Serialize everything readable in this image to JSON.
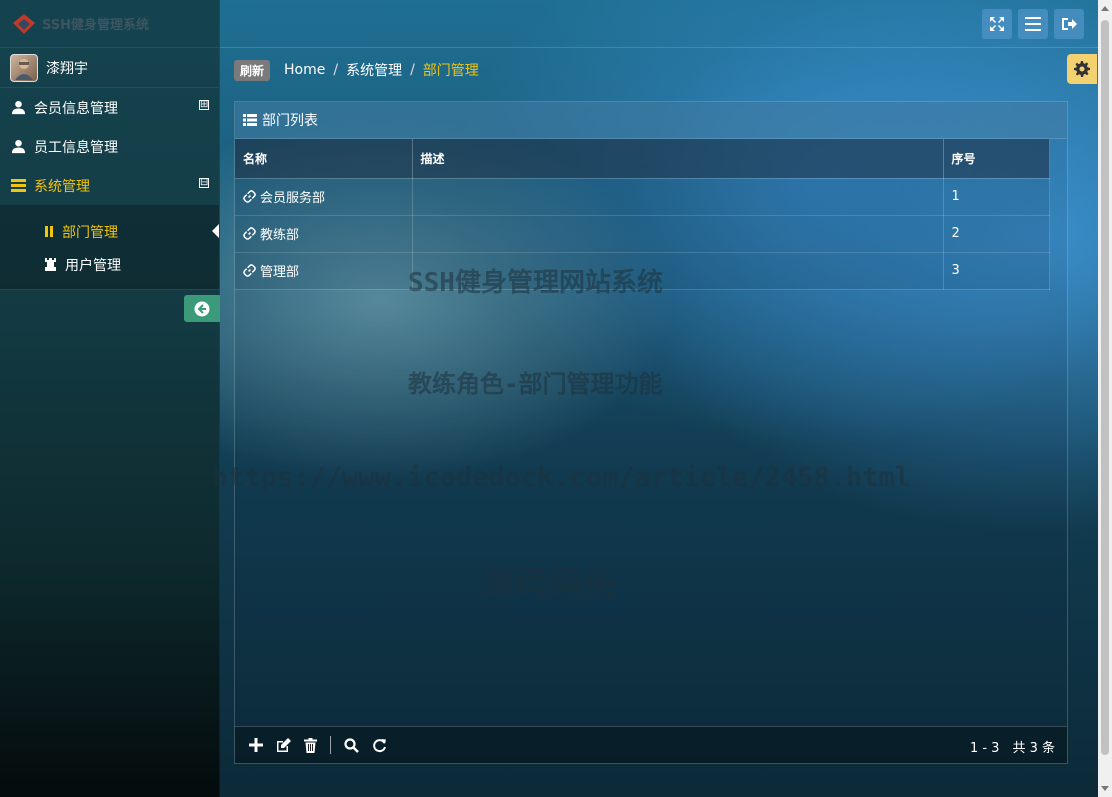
{
  "app": {
    "logo_text": "SSH健身管理系统"
  },
  "user": {
    "name": "漆翔宇"
  },
  "sidebar": {
    "items": [
      {
        "label": "会员信息管理",
        "icon": "user-icon",
        "expand": "⊞"
      },
      {
        "label": "员工信息管理",
        "icon": "user-icon"
      },
      {
        "label": "系统管理",
        "icon": "list-icon",
        "expand": "⊟"
      }
    ],
    "sub_items": [
      {
        "label": "部门管理",
        "icon": "pause-icon"
      },
      {
        "label": "用户管理",
        "icon": "chess-rook-icon"
      }
    ]
  },
  "breadcrumb": {
    "refresh": "刷新",
    "home": "Home",
    "level1": "系统管理",
    "level2": "部门管理",
    "sep": "/"
  },
  "panel": {
    "title": "部门列表",
    "columns": [
      "名称",
      "描述",
      "序号"
    ],
    "rows": [
      {
        "name": "会员服务部",
        "desc": "",
        "order": "1"
      },
      {
        "name": "教练部",
        "desc": "",
        "order": "2"
      },
      {
        "name": "管理部",
        "desc": "",
        "order": "3"
      }
    ],
    "pager": "1 - 3　共 3 条"
  },
  "watermark": {
    "line1": "SSH健身管理网站系统",
    "line2": "教练角色-部门管理功能",
    "line3": "https://www.icodedock.com/article/2458.html",
    "line4": "源码码头"
  },
  "colors": {
    "accent": "#f1c40f",
    "collapse_btn": "#3a9a7a",
    "gear_tab": "#f3d070"
  }
}
